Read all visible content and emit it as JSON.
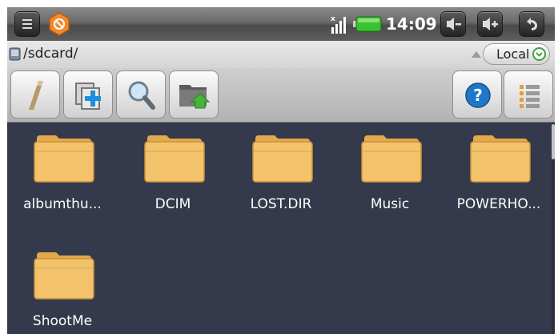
{
  "status_bar": {
    "time": "14:09",
    "battery_color": "#37c22e"
  },
  "path_bar": {
    "path": "/sdcard/",
    "location_label": "Local"
  },
  "toolbar": {
    "buttons": [
      "rename-icon",
      "copy-add-icon",
      "search-icon",
      "move-folder-icon",
      "help-icon",
      "list-view-icon"
    ]
  },
  "files": [
    {
      "name": "albumthu..."
    },
    {
      "name": "DCIM"
    },
    {
      "name": "LOST.DIR"
    },
    {
      "name": "Music"
    },
    {
      "name": "POWERHO..."
    },
    {
      "name": "ShootMe"
    }
  ],
  "colors": {
    "background": "#343a4b",
    "folder": "#f2c36b"
  }
}
